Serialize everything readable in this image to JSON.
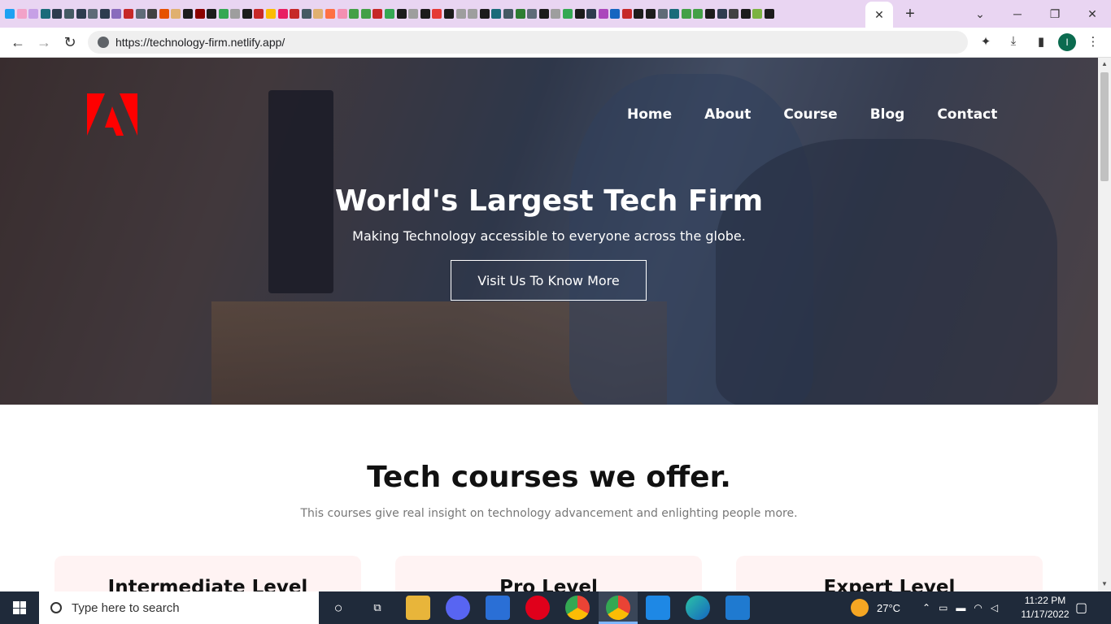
{
  "browser": {
    "tab_close_glyph": "✕",
    "new_tab_glyph": "+",
    "url": "https://technology-firm.netlify.app/",
    "profile_initial": "I",
    "favicon_colors": [
      "#1da1f2",
      "#f2a2c8",
      "#c6a0e6",
      "#1a6b7a",
      "#2e3c4f",
      "#455a64",
      "#2e3c4f",
      "#5f6b78",
      "#2e3c4f",
      "#8a6bbd",
      "#c62828",
      "#5f6b78",
      "#424242",
      "#e65100",
      "#e0b070",
      "#1c1c1c",
      "#8b0000",
      "#1c1c1c",
      "#34a853",
      "#9e9e9e",
      "#1c1c1c",
      "#c62828",
      "#fbbc04",
      "#e91e63",
      "#c62828",
      "#455a64",
      "#e0b070",
      "#ff7043",
      "#f48fb1",
      "#43a047",
      "#43a047",
      "#c62828",
      "#34a853",
      "#1c1c1c",
      "#9e9e9e",
      "#1c1c1c",
      "#e53935",
      "#1c1c1c",
      "#9e9e9e",
      "#9e9e9e",
      "#1c1c1c",
      "#1a6b7a",
      "#455a64",
      "#2e7d32",
      "#5f6b78",
      "#1c1c1c",
      "#9e9e9e",
      "#34a853",
      "#1c1c1c",
      "#2e3c4f",
      "#ab47bc",
      "#1565c0",
      "#c62828",
      "#1c1c1c",
      "#1c1c1c",
      "#5f6b78",
      "#1a6b7a",
      "#43a047",
      "#43a047",
      "#1c1c1c",
      "#2e3c4f",
      "#424242",
      "#1c1c1c",
      "#7cb342",
      "#1c1c1c"
    ]
  },
  "page": {
    "nav": [
      "Home",
      "About",
      "Course",
      "Blog",
      "Contact"
    ],
    "hero": {
      "title": "World's Largest Tech Firm",
      "subtitle": "Making Technology accessible to everyone across the globe.",
      "button": "Visit Us To Know More"
    },
    "courses": {
      "title": "Tech courses we offer.",
      "subtitle": "This courses give real insight on technology advancement and enlighting people more.",
      "cards": [
        "Intermediate Level",
        "Pro Level",
        "Expert Level"
      ]
    }
  },
  "taskbar": {
    "search_placeholder": "Type here to search",
    "weather": "27°C",
    "time": "11:22 PM",
    "date": "11/17/2022"
  }
}
